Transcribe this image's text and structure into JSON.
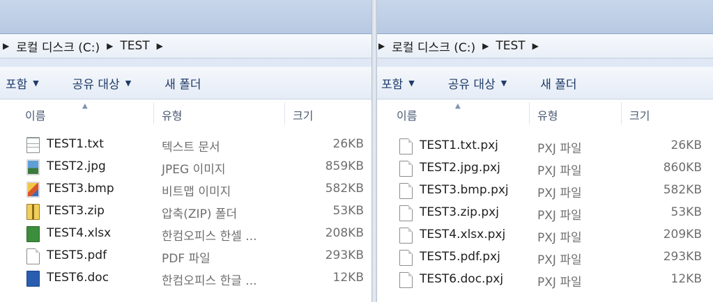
{
  "left": {
    "address": [
      "로컬 디스크 (C:)",
      "TEST"
    ],
    "toolbar": [
      "포함",
      "공유 대상",
      "새 폴더"
    ],
    "columns": {
      "name": "이름",
      "type": "유형",
      "size": "크기"
    },
    "files": [
      {
        "name": "TEST1.txt",
        "type": "텍스트 문서",
        "size": "26KB",
        "icon": "text-file-icon"
      },
      {
        "name": "TEST2.jpg",
        "type": "JPEG 이미지",
        "size": "859KB",
        "icon": "jpeg-image-icon"
      },
      {
        "name": "TEST3.bmp",
        "type": "비트맵 이미지",
        "size": "582KB",
        "icon": "bitmap-image-icon"
      },
      {
        "name": "TEST3.zip",
        "type": "압축(ZIP) 폴더",
        "size": "53KB",
        "icon": "zip-folder-icon"
      },
      {
        "name": "TEST4.xlsx",
        "type": "한컴오피스 한셀 ...",
        "size": "208KB",
        "icon": "spreadsheet-icon"
      },
      {
        "name": "TEST5.pdf",
        "type": "PDF 파일",
        "size": "293KB",
        "icon": "pdf-file-icon"
      },
      {
        "name": "TEST6.doc",
        "type": "한컴오피스 한글 ...",
        "size": "12KB",
        "icon": "word-document-icon"
      }
    ]
  },
  "right": {
    "address": [
      "로컬 디스크 (C:)",
      "TEST"
    ],
    "toolbar": [
      "포함",
      "공유 대상",
      "새 폴더"
    ],
    "columns": {
      "name": "이름",
      "type": "유형",
      "size": "크기"
    },
    "files": [
      {
        "name": "TEST1.txt.pxj",
        "type": "PXJ 파일",
        "size": "26KB",
        "icon": "blank-file-icon"
      },
      {
        "name": "TEST2.jpg.pxj",
        "type": "PXJ 파일",
        "size": "860KB",
        "icon": "blank-file-icon"
      },
      {
        "name": "TEST3.bmp.pxj",
        "type": "PXJ 파일",
        "size": "582KB",
        "icon": "blank-file-icon"
      },
      {
        "name": "TEST3.zip.pxj",
        "type": "PXJ 파일",
        "size": "53KB",
        "icon": "blank-file-icon"
      },
      {
        "name": "TEST4.xlsx.pxj",
        "type": "PXJ 파일",
        "size": "209KB",
        "icon": "blank-file-icon"
      },
      {
        "name": "TEST5.pdf.pxj",
        "type": "PXJ 파일",
        "size": "293KB",
        "icon": "blank-file-icon"
      },
      {
        "name": "TEST6.doc.pxj",
        "type": "PXJ 파일",
        "size": "12KB",
        "icon": "blank-file-icon"
      }
    ]
  }
}
